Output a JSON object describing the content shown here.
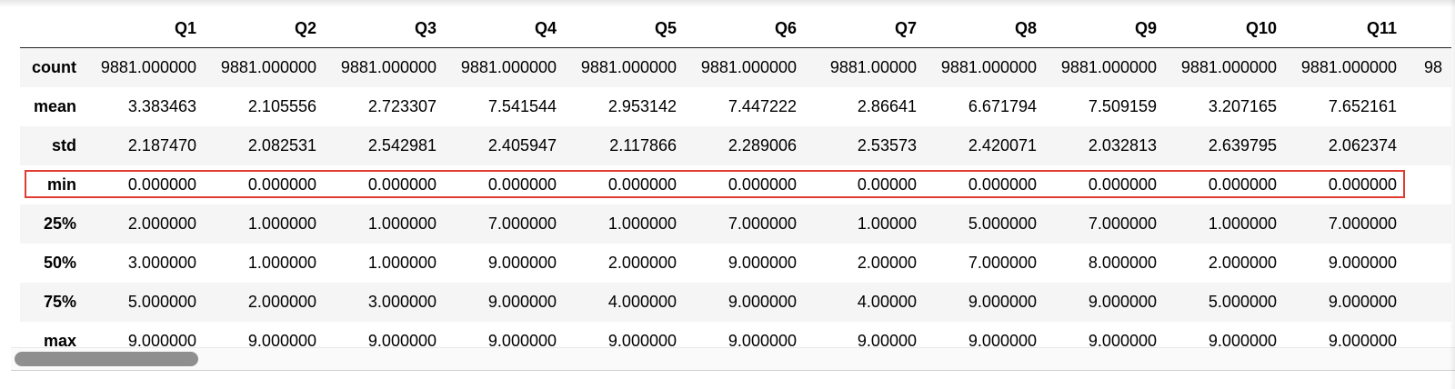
{
  "dataframe": {
    "columns": [
      "",
      "Q1",
      "Q2",
      "Q3",
      "Q4",
      "Q5",
      "Q6",
      "Q7",
      "Q8",
      "Q9",
      "Q10",
      "Q11",
      ""
    ],
    "rows": [
      {
        "label": "count",
        "values": [
          "9881.000000",
          "9881.000000",
          "9881.000000",
          "9881.000000",
          "9881.000000",
          "9881.000000",
          "9881.00000",
          "9881.000000",
          "9881.000000",
          "9881.000000",
          "9881.000000",
          "98"
        ]
      },
      {
        "label": "mean",
        "values": [
          "3.383463",
          "2.105556",
          "2.723307",
          "7.541544",
          "2.953142",
          "7.447222",
          "2.86641",
          "6.671794",
          "7.509159",
          "3.207165",
          "7.652161",
          ""
        ]
      },
      {
        "label": "std",
        "values": [
          "2.187470",
          "2.082531",
          "2.542981",
          "2.405947",
          "2.117866",
          "2.289006",
          "2.53573",
          "2.420071",
          "2.032813",
          "2.639795",
          "2.062374",
          ""
        ]
      },
      {
        "label": "min",
        "values": [
          "0.000000",
          "0.000000",
          "0.000000",
          "0.000000",
          "0.000000",
          "0.000000",
          "0.00000",
          "0.000000",
          "0.000000",
          "0.000000",
          "0.000000",
          ""
        ]
      },
      {
        "label": "25%",
        "values": [
          "2.000000",
          "1.000000",
          "1.000000",
          "7.000000",
          "1.000000",
          "7.000000",
          "1.00000",
          "5.000000",
          "7.000000",
          "1.000000",
          "7.000000",
          ""
        ]
      },
      {
        "label": "50%",
        "values": [
          "3.000000",
          "1.000000",
          "1.000000",
          "9.000000",
          "2.000000",
          "9.000000",
          "2.00000",
          "7.000000",
          "8.000000",
          "2.000000",
          "9.000000",
          ""
        ]
      },
      {
        "label": "75%",
        "values": [
          "5.000000",
          "2.000000",
          "3.000000",
          "9.000000",
          "4.000000",
          "9.000000",
          "4.00000",
          "9.000000",
          "9.000000",
          "5.000000",
          "9.000000",
          ""
        ]
      },
      {
        "label": "max",
        "values": [
          "9.000000",
          "9.000000",
          "9.000000",
          "9.000000",
          "9.000000",
          "9.000000",
          "9.00000",
          "9.000000",
          "9.000000",
          "9.000000",
          "9.000000",
          ""
        ]
      }
    ]
  },
  "highlight": {
    "row_label": "min",
    "color": "#e03c31"
  },
  "colors": {
    "row_stripe": "#f5f5f5",
    "scroll_thumb": "#8f8f8f"
  }
}
